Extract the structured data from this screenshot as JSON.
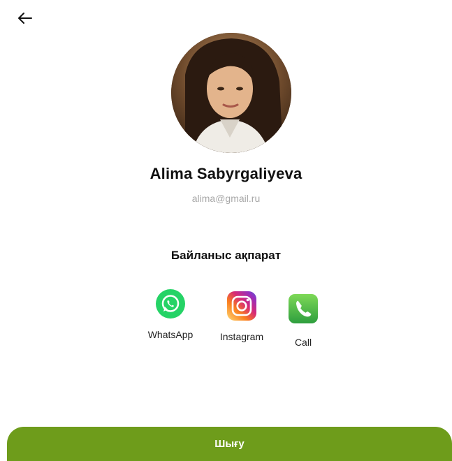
{
  "header": {
    "back_icon": "arrow-left-icon"
  },
  "profile": {
    "name": "Alima Sabyrgaliyeva",
    "email": "alima@gmail.ru",
    "avatar": "profile-photo"
  },
  "contacts": {
    "title": "Байланыс ақпарат",
    "items": [
      {
        "label": "WhatsApp",
        "icon": "whatsapp-icon",
        "color": "#25d366"
      },
      {
        "label": "Instagram",
        "icon": "instagram-icon",
        "color": "#c13584"
      },
      {
        "label": "Call",
        "icon": "phone-icon",
        "color": "#4caf50"
      }
    ]
  },
  "actions": {
    "logout_label": "Шығу",
    "logout_color": "#6e9c1b"
  }
}
